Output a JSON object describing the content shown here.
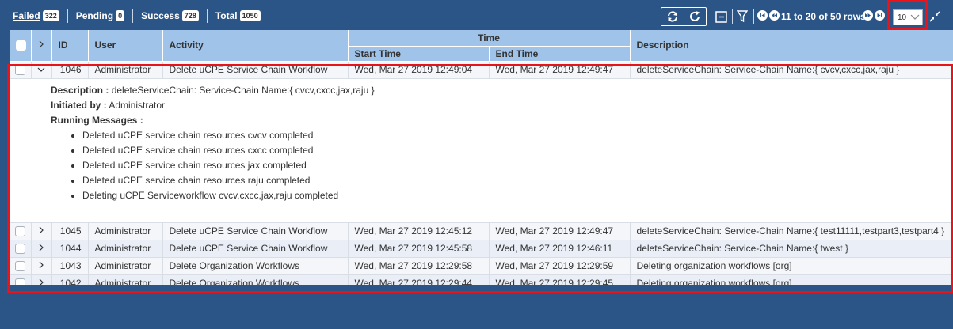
{
  "toolbar": {
    "filters": [
      {
        "label": "Failed",
        "count": "322"
      },
      {
        "label": "Pending",
        "count": "0"
      },
      {
        "label": "Success",
        "count": "728"
      },
      {
        "label": "Total",
        "count": "1050"
      }
    ],
    "pager_text": "11 to 20 of 50 rows",
    "page_size": "10"
  },
  "columns": {
    "id": "ID",
    "user": "User",
    "activity": "Activity",
    "time": "Time",
    "start_time": "Start Time",
    "end_time": "End Time",
    "description": "Description"
  },
  "rows": [
    {
      "id": "1046",
      "user": "Administrator",
      "activity": "Delete uCPE Service Chain Workflow",
      "start": "Wed, Mar 27 2019 12:49:04",
      "end": "Wed, Mar 27 2019 12:49:47",
      "description": "deleteServiceChain: Service-Chain Name:{ cvcv,cxcc,jax,raju }"
    },
    {
      "id": "1045",
      "user": "Administrator",
      "activity": "Delete uCPE Service Chain Workflow",
      "start": "Wed, Mar 27 2019 12:45:12",
      "end": "Wed, Mar 27 2019 12:49:47",
      "description": "deleteServiceChain: Service-Chain Name:{ test11111,testpart3,testpart4 }"
    },
    {
      "id": "1044",
      "user": "Administrator",
      "activity": "Delete uCPE Service Chain Workflow",
      "start": "Wed, Mar 27 2019 12:45:58",
      "end": "Wed, Mar 27 2019 12:46:11",
      "description": "deleteServiceChain: Service-Chain Name:{ twest }"
    },
    {
      "id": "1043",
      "user": "Administrator",
      "activity": "Delete Organization Workflows",
      "start": "Wed, Mar 27 2019 12:29:58",
      "end": "Wed, Mar 27 2019 12:29:59",
      "description": "Deleting organization workflows [org]"
    },
    {
      "id": "1042",
      "user": "Administrator",
      "activity": "Delete Organization Workflows",
      "start": "Wed, Mar 27 2019 12:29:44",
      "end": "Wed, Mar 27 2019 12:29:45",
      "description": "Deleting organization workflows [org]"
    }
  ],
  "detail": {
    "description_label": "Description :",
    "description_value": "deleteServiceChain: Service-Chain Name:{ cvcv,cxcc,jax,raju }",
    "initiated_label": "Initiated by :",
    "initiated_value": "Administrator",
    "messages_label": "Running Messages :",
    "messages": [
      "Deleted uCPE service chain resources cvcv completed",
      "Deleted uCPE service chain resources cxcc completed",
      "Deleted uCPE service chain resources jax completed",
      "Deleted uCPE service chain resources raju completed",
      "Deleting uCPE Serviceworkflow cvcv,cxcc,jax,raju completed"
    ]
  },
  "colors": {
    "background": "#2a5586",
    "header": "#9fc3e9",
    "highlight": "#e8141b"
  }
}
